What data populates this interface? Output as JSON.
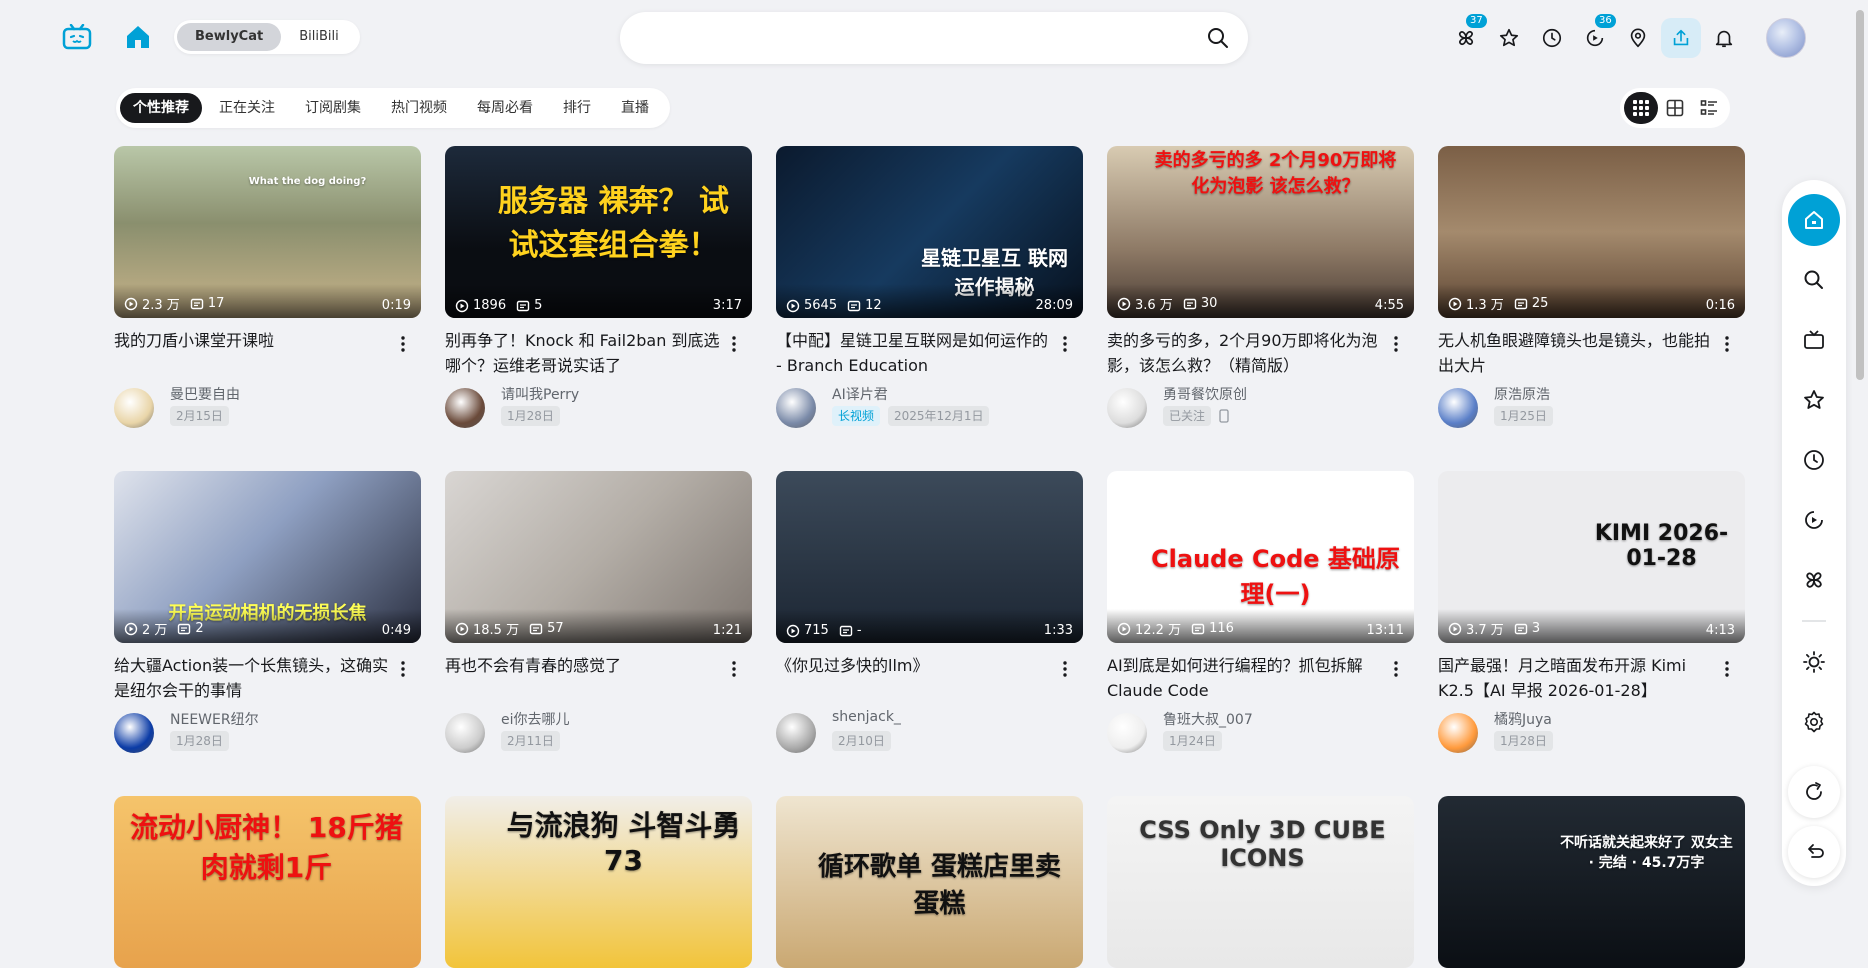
{
  "header": {
    "source_switch": [
      "BewlyCat",
      "BiliBili"
    ],
    "search_placeholder": "",
    "badges": {
      "moments": "37",
      "history_live": "36"
    }
  },
  "tabs": [
    "个性推荐",
    "正在关注",
    "订阅剧集",
    "热门视频",
    "每周必看",
    "排行",
    "直播"
  ],
  "cards": [
    {
      "views": "2.3 万",
      "danmaku": "17",
      "duration": "0:19",
      "title": "我的刀盾小课堂开课啦",
      "up": "曼巴要自由",
      "tags": [
        "2月15日"
      ],
      "thumb_text": "What the dog doing?"
    },
    {
      "views": "1896",
      "danmaku": "5",
      "duration": "3:17",
      "title": "别再争了！Knock 和 Fail2ban 到底选哪个？运维老哥说实话了",
      "up": "请叫我Perry",
      "tags": [
        "1月28日"
      ],
      "thumb_text": "服务器 裸奔？ 试试这套组合拳！"
    },
    {
      "views": "5645",
      "danmaku": "12",
      "duration": "28:09",
      "title": "【中配】星链卫星互联网是如何运作的 - Branch Education",
      "up": "AI译片君",
      "tags": [
        "长视频",
        "2025年12月1日"
      ],
      "thumb_text": "星链卫星互 联网运作揭秘"
    },
    {
      "views": "3.6 万",
      "danmaku": "30",
      "duration": "4:55",
      "title": "卖的多亏的多，2个月90万即将化为泡影，该怎么救？（精简版）",
      "up": "勇哥餐饮原创",
      "tags": [
        "已关注"
      ],
      "thumb_text": "卖的多亏的多 2个月90万即将化为泡影 该怎么救？"
    },
    {
      "views": "1.3 万",
      "danmaku": "25",
      "duration": "0:16",
      "title": "无人机鱼眼避障镜头也是镜头，也能拍出大片",
      "up": "原浩原浩",
      "tags": [
        "1月25日"
      ],
      "thumb_text": ""
    },
    {
      "views": "2 万",
      "danmaku": "2",
      "duration": "0:49",
      "title": "给大疆Action装一个长焦镜头，这确实是纽尔会干的事情",
      "up": "NEEWER纽尔",
      "tags": [
        "1月28日"
      ],
      "thumb_text": "开启运动相机的无损长焦"
    },
    {
      "views": "18.5 万",
      "danmaku": "57",
      "duration": "1:21",
      "title": "再也不会有青春的感觉了",
      "up": "ei你去哪儿",
      "tags": [
        "2月11日"
      ],
      "thumb_text": ""
    },
    {
      "views": "715",
      "danmaku": "-",
      "duration": "1:33",
      "title": "《你见过多快的llm》",
      "up": "shenjack_",
      "tags": [
        "2月10日"
      ],
      "thumb_text": ""
    },
    {
      "views": "12.2 万",
      "danmaku": "116",
      "duration": "13:11",
      "title": "AI到底是如何进行编程的？抓包拆解Claude Code",
      "up": "鲁班大叔_007",
      "tags": [
        "1月24日"
      ],
      "thumb_text": "Claude Code 基础原理(一)"
    },
    {
      "views": "3.7 万",
      "danmaku": "3",
      "duration": "4:13",
      "title": "国产最强！月之暗面发布开源 Kimi K2.5【AI 早报 2026-01-28】",
      "up": "橘鸦Juya",
      "tags": [
        "1月28日"
      ],
      "thumb_text": "KIMI 2026-01-28"
    },
    {
      "views": "",
      "danmaku": "",
      "duration": "",
      "title": "",
      "up": "",
      "tags": [],
      "thumb_text": "流动小厨神！ 18斤猪肉就剩1斤"
    },
    {
      "views": "",
      "danmaku": "",
      "duration": "",
      "title": "",
      "up": "",
      "tags": [],
      "thumb_text": "与流浪狗 斗智斗勇73"
    },
    {
      "views": "",
      "danmaku": "",
      "duration": "",
      "title": "",
      "up": "",
      "tags": [],
      "thumb_text": "循环歌单 蛋糕店里卖蛋糕"
    },
    {
      "views": "",
      "danmaku": "",
      "duration": "",
      "title": "",
      "up": "",
      "tags": [],
      "thumb_text": "CSS Only 3D CUBE ICONS"
    },
    {
      "views": "",
      "danmaku": "",
      "duration": "",
      "title": "",
      "up": "",
      "tags": [],
      "thumb_text": "不听话就关起来好了 双女主 · 完结 · 45.7万字"
    }
  ],
  "colors": {
    "accent": "#00a1d6",
    "bg": "#f1f2f5",
    "text": "#18191c",
    "muted": "#9499a0"
  }
}
